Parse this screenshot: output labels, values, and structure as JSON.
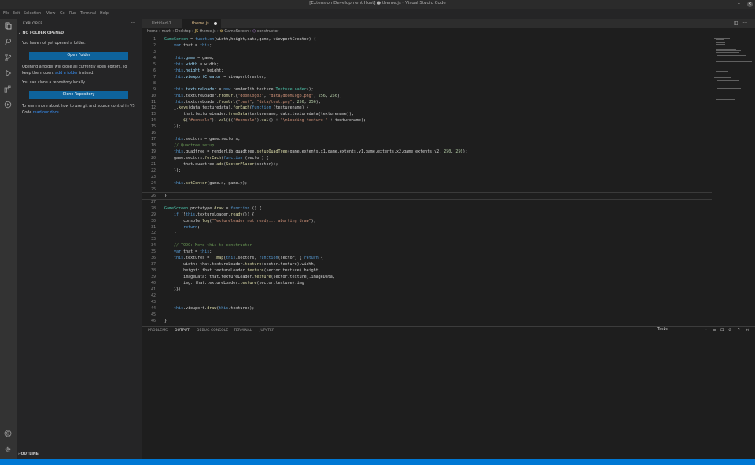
{
  "window": {
    "title": "[Extension Development Host] ● theme.js - Visual Studio Code"
  },
  "menu": [
    "File",
    "Edit",
    "Selection",
    "View",
    "Go",
    "Run",
    "Terminal",
    "Help"
  ],
  "sidebar": {
    "title": "EXPLORER",
    "section": "NO FOLDER OPENED",
    "msg1": "You have not yet opened a folder.",
    "open_folder": "Open Folder",
    "msg2a": "Opening a folder will close all currently open editors. To keep them open, ",
    "msg2_link": "add a folder",
    "msg2b": " instead.",
    "msg3": "You can clone a repository locally.",
    "clone": "Clone Repository",
    "msg4a": "To learn more about how to use git and source control in VS Code ",
    "msg4_link": "read our docs",
    "msg4b": ".",
    "outline": "OUTLINE"
  },
  "tabs": [
    {
      "label": "Untitled-1"
    },
    {
      "label": "theme.js"
    }
  ],
  "breadcrumb": [
    "home",
    "mark",
    "Desktop",
    "theme.js",
    "GameScreen",
    "constructor"
  ],
  "panel": {
    "tabs": [
      "PROBLEMS",
      "OUTPUT",
      "DEBUG CONSOLE",
      "TERMINAL",
      "JUPYTER"
    ],
    "active": "OUTPUT",
    "select": "Tasks"
  },
  "code_lines": [
    [
      [
        "t",
        "GameScreen"
      ],
      [
        "p",
        " = "
      ],
      [
        "k",
        "function"
      ],
      [
        "p",
        "(width,height,data,game, viewportCreator) {"
      ]
    ],
    [
      [
        "p",
        "    "
      ],
      [
        "k",
        "var"
      ],
      [
        "p",
        " that = "
      ],
      [
        "k",
        "this"
      ],
      [
        "p",
        ";"
      ]
    ],
    [],
    [
      [
        "p",
        "    "
      ],
      [
        "k",
        "this"
      ],
      [
        "v",
        ".game"
      ],
      [
        "p",
        " = game;"
      ]
    ],
    [
      [
        "p",
        "    "
      ],
      [
        "k",
        "this"
      ],
      [
        "v",
        ".width"
      ],
      [
        "p",
        " = width;"
      ]
    ],
    [
      [
        "p",
        "    "
      ],
      [
        "k",
        "this"
      ],
      [
        "v",
        ".height"
      ],
      [
        "p",
        " = height;"
      ]
    ],
    [
      [
        "p",
        "    "
      ],
      [
        "k",
        "this"
      ],
      [
        "v",
        ".viewportCreator"
      ],
      [
        "p",
        " = viewportCreator;"
      ]
    ],
    [],
    [
      [
        "p",
        "    "
      ],
      [
        "k",
        "this"
      ],
      [
        "v",
        ".textureLoader"
      ],
      [
        "p",
        " = "
      ],
      [
        "k",
        "new"
      ],
      [
        "p",
        " renderlib.texture."
      ],
      [
        "t",
        "TextureLoader"
      ],
      [
        "p",
        "();"
      ]
    ],
    [
      [
        "p",
        "    "
      ],
      [
        "k",
        "this"
      ],
      [
        "p",
        ".textureLoader."
      ],
      [
        "f",
        "fromUrl"
      ],
      [
        "p",
        "("
      ],
      [
        "s",
        "\"doomlogo2\""
      ],
      [
        "p",
        ", "
      ],
      [
        "s",
        "\"data/doomlogo.png\""
      ],
      [
        "p",
        ", "
      ],
      [
        "n",
        "256"
      ],
      [
        "p",
        ", "
      ],
      [
        "n",
        "256"
      ],
      [
        "p",
        ");"
      ]
    ],
    [
      [
        "p",
        "    "
      ],
      [
        "k",
        "this"
      ],
      [
        "p",
        ".textureLoader."
      ],
      [
        "f",
        "fromUrl"
      ],
      [
        "p",
        "("
      ],
      [
        "s",
        "\"test\""
      ],
      [
        "p",
        ", "
      ],
      [
        "s",
        "\"data/test.png\""
      ],
      [
        "p",
        ", "
      ],
      [
        "n",
        "256"
      ],
      [
        "p",
        ", "
      ],
      [
        "n",
        "256"
      ],
      [
        "p",
        ");"
      ]
    ],
    [
      [
        "p",
        "    _."
      ],
      [
        "f",
        "keys"
      ],
      [
        "p",
        "(data.texturedata)."
      ],
      [
        "f",
        "forEach"
      ],
      [
        "p",
        "("
      ],
      [
        "k",
        "function"
      ],
      [
        "p",
        " (texturename) {"
      ]
    ],
    [
      [
        "p",
        "        that.textureLoader."
      ],
      [
        "f",
        "fromData"
      ],
      [
        "p",
        "(texturename, data.texturedata[texturename]);"
      ]
    ],
    [
      [
        "p",
        "        "
      ],
      [
        "f",
        "$"
      ],
      [
        "p",
        "("
      ],
      [
        "s",
        "\"#console\""
      ],
      [
        "p",
        "). "
      ],
      [
        "f",
        "val"
      ],
      [
        "p",
        "("
      ],
      [
        "f",
        "$"
      ],
      [
        "p",
        "("
      ],
      [
        "s",
        "\"#console\""
      ],
      [
        "p",
        ")."
      ],
      [
        "f",
        "val"
      ],
      [
        "p",
        "() + "
      ],
      [
        "s",
        "\"\\nLoading texture \""
      ],
      [
        "p",
        " + texturename);"
      ]
    ],
    [
      [
        "p",
        "    });"
      ]
    ],
    [],
    [
      [
        "p",
        "    "
      ],
      [
        "k",
        "this"
      ],
      [
        "p",
        ".sectors = game.sectors;"
      ]
    ],
    [
      [
        "c",
        "    // Quadtree setup"
      ]
    ],
    [
      [
        "p",
        "    "
      ],
      [
        "k",
        "this"
      ],
      [
        "p",
        ".quadtree = renderlib.quadtree."
      ],
      [
        "f",
        "setupQuadTree"
      ],
      [
        "p",
        "(game.extents.x1,game.extents.y1,game.extents.x2,game.extents.y2, "
      ],
      [
        "n",
        "250"
      ],
      [
        "p",
        ", "
      ],
      [
        "n",
        "250"
      ],
      [
        "p",
        ");"
      ]
    ],
    [
      [
        "p",
        "    game.sectors."
      ],
      [
        "f",
        "forEach"
      ],
      [
        "p",
        "("
      ],
      [
        "k",
        "function"
      ],
      [
        "p",
        " (sector) {"
      ]
    ],
    [
      [
        "p",
        "        that.quadtree."
      ],
      [
        "f",
        "add"
      ],
      [
        "p",
        "("
      ],
      [
        "f",
        "SectorPlacer"
      ],
      [
        "p",
        "(sector));"
      ]
    ],
    [
      [
        "p",
        "    });"
      ]
    ],
    [],
    [
      [
        "p",
        "    "
      ],
      [
        "k",
        "this"
      ],
      [
        "p",
        "."
      ],
      [
        "f",
        "setCenter"
      ],
      [
        "p",
        "(game.x, game.y);"
      ]
    ],
    [],
    [
      [
        "p",
        "}"
      ]
    ],
    [],
    [
      [
        "t",
        "GameScreen"
      ],
      [
        "p",
        ".prototype."
      ],
      [
        "f",
        "draw"
      ],
      [
        "p",
        " = "
      ],
      [
        "k",
        "function"
      ],
      [
        "p",
        " () {"
      ]
    ],
    [
      [
        "p",
        "    "
      ],
      [
        "k",
        "if"
      ],
      [
        "p",
        " (!"
      ],
      [
        "k",
        "this"
      ],
      [
        "p",
        ".textureLoader."
      ],
      [
        "f",
        "ready"
      ],
      [
        "p",
        "()) {"
      ]
    ],
    [
      [
        "p",
        "        console."
      ],
      [
        "f",
        "log"
      ],
      [
        "p",
        "("
      ],
      [
        "s",
        "\"Textureloader not ready... aborting draw\""
      ],
      [
        "p",
        ");"
      ]
    ],
    [
      [
        "p",
        "        "
      ],
      [
        "k",
        "return"
      ],
      [
        "p",
        ";"
      ]
    ],
    [
      [
        "p",
        "    }"
      ]
    ],
    [],
    [
      [
        "c",
        "    // TODO: Move this to constructor"
      ]
    ],
    [
      [
        "p",
        "    "
      ],
      [
        "k",
        "var"
      ],
      [
        "p",
        " that = "
      ],
      [
        "k",
        "this"
      ],
      [
        "p",
        ";"
      ]
    ],
    [
      [
        "p",
        "    "
      ],
      [
        "k",
        "this"
      ],
      [
        "p",
        ".textures = _."
      ],
      [
        "f",
        "map"
      ],
      [
        "p",
        "("
      ],
      [
        "k",
        "this"
      ],
      [
        "p",
        ".sectors, "
      ],
      [
        "k",
        "function"
      ],
      [
        "p",
        "(sector) { "
      ],
      [
        "k",
        "return"
      ],
      [
        "p",
        " {"
      ]
    ],
    [
      [
        "p",
        "        width: that.textureLoader."
      ],
      [
        "f",
        "texture"
      ],
      [
        "p",
        "(sector.texture).width,"
      ]
    ],
    [
      [
        "p",
        "        height: that.textureLoader."
      ],
      [
        "f",
        "texture"
      ],
      [
        "p",
        "(sector.texture).height,"
      ]
    ],
    [
      [
        "p",
        "        imageData: that.textureLoader."
      ],
      [
        "f",
        "texture"
      ],
      [
        "p",
        "(sector.texture).imageData,"
      ]
    ],
    [
      [
        "p",
        "        img: that.textureLoader."
      ],
      [
        "f",
        "texture"
      ],
      [
        "p",
        "(sector.texture).img"
      ]
    ],
    [
      [
        "p",
        "    }});"
      ]
    ],
    [],
    [],
    [
      [
        "p",
        "    "
      ],
      [
        "k",
        "this"
      ],
      [
        "p",
        ".viewport."
      ],
      [
        "f",
        "draw"
      ],
      [
        "p",
        "("
      ],
      [
        "k",
        "this"
      ],
      [
        "p",
        ".textures);"
      ]
    ],
    [],
    [
      [
        "p",
        "}"
      ]
    ]
  ]
}
